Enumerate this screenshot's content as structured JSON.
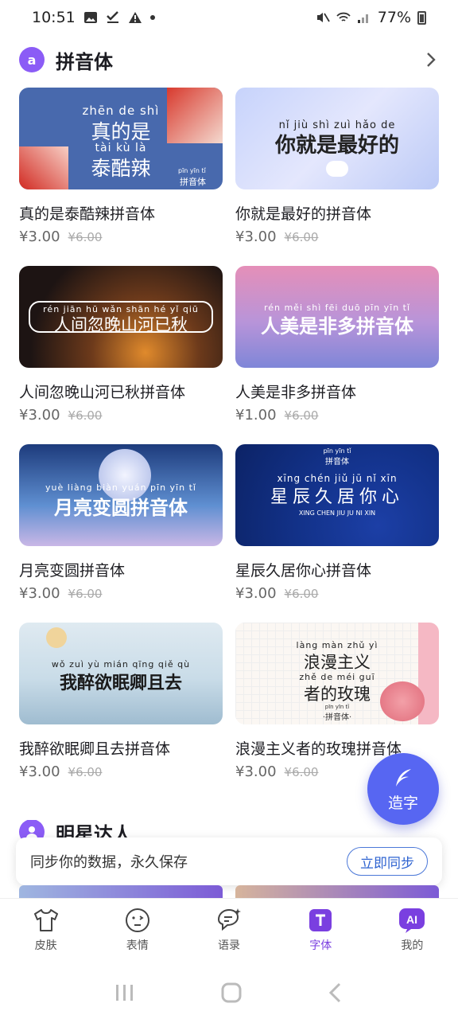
{
  "status": {
    "time": "10:51",
    "battery": "77%"
  },
  "section": {
    "title": "拼音体",
    "icon_text": "a"
  },
  "fonts": [
    {
      "name": "真的是泰酷辣拼音体",
      "price": "¥3.00",
      "original_price": "¥6.00",
      "art": {
        "pinyin1": "zhēn  de  shì",
        "hanzi1": "真的是",
        "pinyin2": "tài  kù  là",
        "hanzi2": "泰酷辣",
        "tag_pinyin": "pīn yīn tǐ",
        "tag": "拼音体"
      }
    },
    {
      "name": "你就是最好的拼音体",
      "price": "¥3.00",
      "original_price": "¥6.00",
      "art": {
        "pinyin1": "nǐ  jiù  shì  zuì  hǎo  de",
        "hanzi1": "你就是最好的"
      }
    },
    {
      "name": "人间忽晚山河已秋拼音体",
      "price": "¥3.00",
      "original_price": "¥6.00",
      "art": {
        "pinyin1": "rén  jiān  hū  wǎn shān  hé  yǐ  qiū",
        "hanzi1": "人间忽晚山河已秋"
      }
    },
    {
      "name": "人美是非多拼音体",
      "price": "¥1.00",
      "original_price": "¥6.00",
      "art": {
        "pinyin1": "rén  měi  shì  fēi  duō  pīn  yīn  tǐ",
        "hanzi1": "人美是非多拼音体"
      }
    },
    {
      "name": "月亮变圆拼音体",
      "price": "¥3.00",
      "original_price": "¥6.00",
      "art": {
        "pinyin1": "yuè  liàng  biàn  yuán  pīn  yīn  tǐ",
        "hanzi1": "月亮变圆拼音体"
      }
    },
    {
      "name": "星辰久居你心拼音体",
      "price": "¥3.00",
      "original_price": "¥6.00",
      "art": {
        "tag_pinyin": "pīn yīn tǐ",
        "tag": "拼音体",
        "pinyin1": "xīng  chén  jiǔ  jū  nǐ  xīn",
        "hanzi1": "星辰久居你心",
        "caps": "XING CHEN JIU JU NI XIN"
      }
    },
    {
      "name": "我醉欲眠卿且去拼音体",
      "price": "¥3.00",
      "original_price": "¥6.00",
      "art": {
        "pinyin1": "wǒ  zuì  yù  mián  qīng  qiě  qù",
        "hanzi1": "我醉欲眠卿且去"
      }
    },
    {
      "name": "浪漫主义者的玫瑰拼音体",
      "price": "¥3.00",
      "original_price": "¥6.00",
      "art": {
        "pinyin1": "làng  màn  zhǔ  yì",
        "hanzi1": "浪漫主义",
        "pinyin2": "zhě  de  méi  guī",
        "hanzi2": "者的玫瑰",
        "tag_pinyin": "pīn yīn tǐ",
        "tag": "·拼音体·"
      }
    }
  ],
  "fab": {
    "label": "造字"
  },
  "section2": {
    "title": "明星达人"
  },
  "sync_banner": {
    "text": "同步你的数据，永久保存",
    "button": "立即同步"
  },
  "bottom_nav": [
    {
      "label": "皮肤",
      "icon": "shirt-icon"
    },
    {
      "label": "表情",
      "icon": "face-icon"
    },
    {
      "label": "语录",
      "icon": "quote-icon"
    },
    {
      "label": "字体",
      "icon": "font-icon",
      "active": true
    },
    {
      "label": "我的",
      "icon": "ai-icon"
    }
  ],
  "colors": {
    "accent": "#7a3fe0",
    "fab": "#5766f2",
    "sync_border": "#4b78d8"
  }
}
